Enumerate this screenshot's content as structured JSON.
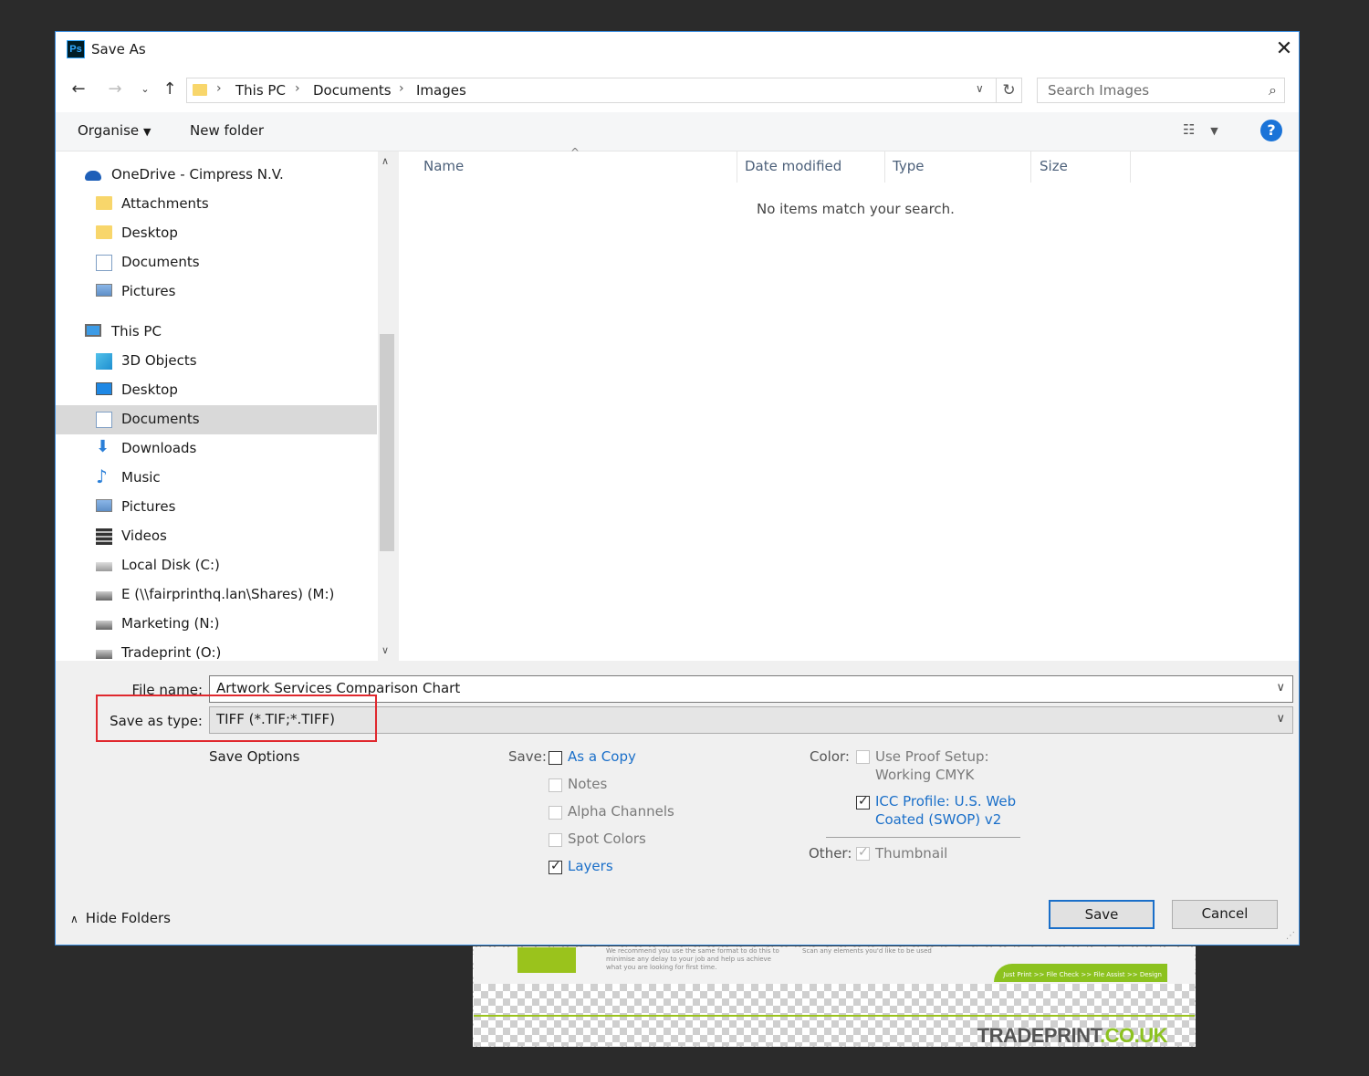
{
  "dialog": {
    "title": "Save As",
    "app_icon": "Ps",
    "close_icon": "✕"
  },
  "nav": {
    "breadcrumb": [
      "This PC",
      "Documents",
      "Images"
    ],
    "search_placeholder": "Search Images"
  },
  "toolbar": {
    "organise_label": "Organise",
    "new_folder_label": "New folder"
  },
  "sidebar": {
    "items": [
      {
        "label": "OneDrive - Cimpress N.V.",
        "icon": "onedrive-icon"
      },
      {
        "label": "Attachments",
        "icon": "folder-icon"
      },
      {
        "label": "Desktop",
        "icon": "folder-icon"
      },
      {
        "label": "Documents",
        "icon": "document-icon"
      },
      {
        "label": "Pictures",
        "icon": "pictures-icon"
      },
      {
        "label": "This PC",
        "icon": "computer-icon"
      },
      {
        "label": "3D Objects",
        "icon": "3d-objects-icon"
      },
      {
        "label": "Desktop",
        "icon": "desktop-icon"
      },
      {
        "label": "Documents",
        "icon": "document-icon",
        "selected": true
      },
      {
        "label": "Downloads",
        "icon": "download-icon"
      },
      {
        "label": "Music",
        "icon": "music-icon"
      },
      {
        "label": "Pictures",
        "icon": "pictures-icon"
      },
      {
        "label": "Videos",
        "icon": "video-icon"
      },
      {
        "label": "Local Disk (C:)",
        "icon": "disk-icon"
      },
      {
        "label": "E (\\\\fairprinthq.lan\\Shares) (M:)",
        "icon": "network-drive-icon"
      },
      {
        "label": "Marketing (N:)",
        "icon": "network-drive-icon"
      },
      {
        "label": "Tradeprint (O:)",
        "icon": "network-drive-icon"
      }
    ]
  },
  "file_list": {
    "columns": [
      "Name",
      "Date modified",
      "Type",
      "Size"
    ],
    "empty_message": "No items match your search."
  },
  "form": {
    "file_name_label": "File name:",
    "file_name_value": "Artwork Services Comparison Chart",
    "save_type_label": "Save as type:",
    "save_type_value": "TIFF (*.TIF;*.TIFF)"
  },
  "save_options": {
    "heading": "Save Options",
    "save_label": "Save:",
    "save_items": [
      {
        "label": "As a Copy",
        "checked": false,
        "enabled": true
      },
      {
        "label": "Notes",
        "checked": false,
        "enabled": false
      },
      {
        "label": "Alpha Channels",
        "checked": false,
        "enabled": false
      },
      {
        "label": "Spot Colors",
        "checked": false,
        "enabled": false
      },
      {
        "label": "Layers",
        "checked": true,
        "enabled": true
      }
    ],
    "color_label": "Color:",
    "proof_setup_line1": "Use Proof Setup:",
    "proof_setup_line2": "Working CMYK",
    "icc_line1": "ICC Profile:  U.S. Web",
    "icc_line2": "Coated (SWOP) v2",
    "other_label": "Other:",
    "thumbnail_label": "Thumbnail"
  },
  "footer": {
    "hide_folders_label": "Hide Folders",
    "save_button": "Save",
    "cancel_button": "Cancel"
  },
  "background_doc": {
    "logo_text": "TRADEPRINT",
    "logo_suffix": ".CO.UK",
    "small_text_1": "We recommend you use the same format to do this to minimise any delay to your job and help us achieve what you are looking for first time.",
    "small_text_2": "Scan any elements you'd like to be used",
    "tab_text": "Just Print >> File Check >> File Assist >> Design"
  },
  "colors": {
    "accent": "#1a6fc9",
    "highlight_box": "#e0282e",
    "selection": "#d9d9d9"
  }
}
